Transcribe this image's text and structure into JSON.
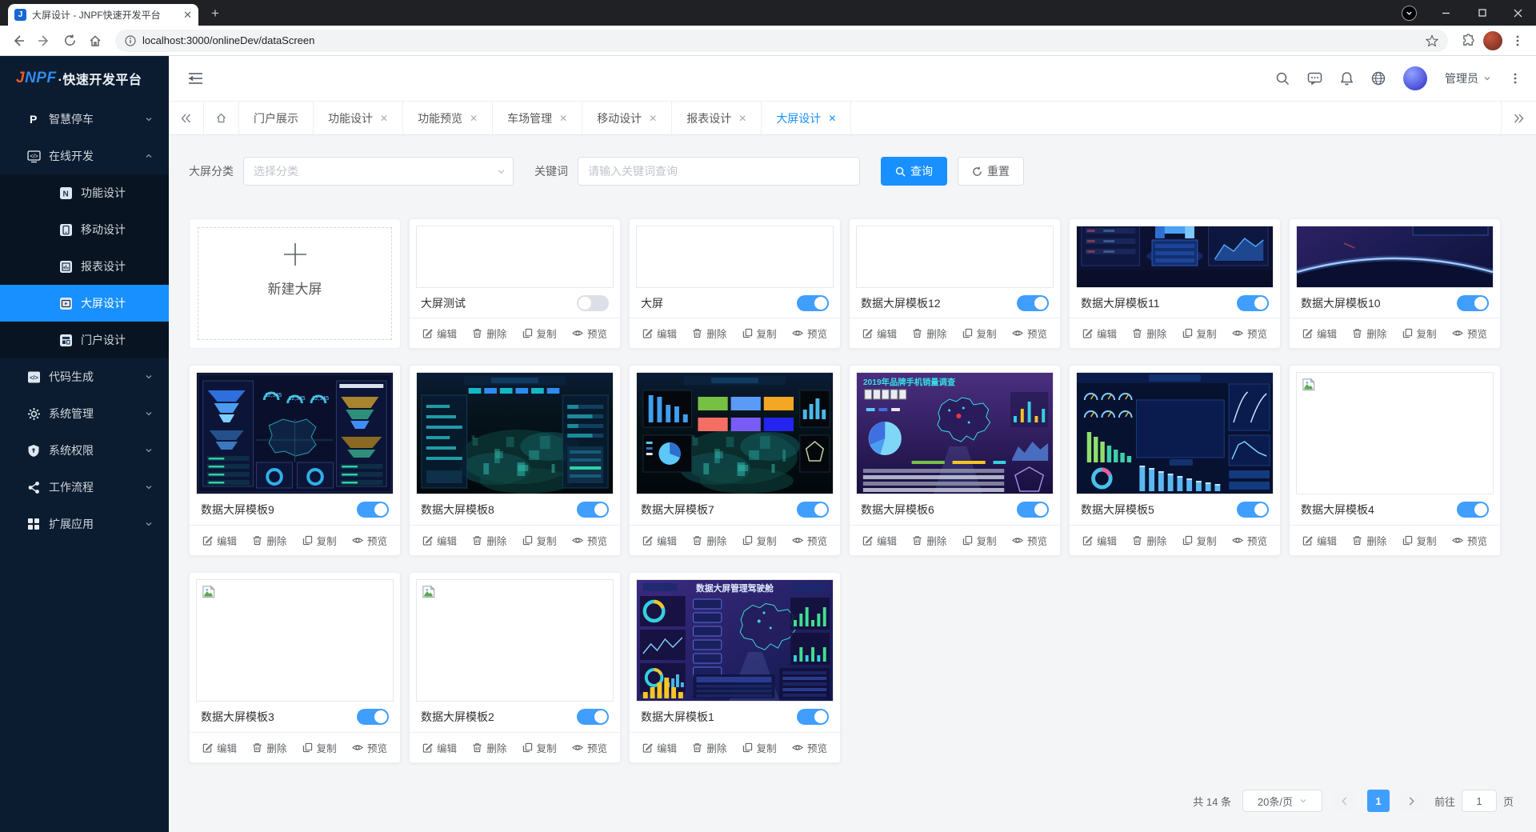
{
  "browser": {
    "tab_title": "大屏设计 - JNPF快速开发平台",
    "url": "localhost:3000/onlineDev/dataScreen"
  },
  "logo": {
    "j": "J",
    "npf": "NPF",
    "rest": "·快速开发平台"
  },
  "sidebar": {
    "items": [
      {
        "label": "智慧停车",
        "icon": "parking-p",
        "level": 1,
        "chevron": "down"
      },
      {
        "label": "在线开发",
        "icon": "online-dev",
        "level": 1,
        "chevron": "up"
      },
      {
        "label": "功能设计",
        "icon": "func-design",
        "level": 2
      },
      {
        "label": "移动设计",
        "icon": "mobile-design",
        "level": 2
      },
      {
        "label": "报表设计",
        "icon": "report-design",
        "level": 2
      },
      {
        "label": "大屏设计",
        "icon": "screen-design",
        "level": 2,
        "active": true
      },
      {
        "label": "门户设计",
        "icon": "portal-design",
        "level": 2
      },
      {
        "label": "代码生成",
        "icon": "code-gen",
        "level": 1,
        "chevron": "down"
      },
      {
        "label": "系统管理",
        "icon": "gear",
        "level": 1,
        "chevron": "down"
      },
      {
        "label": "系统权限",
        "icon": "shield",
        "level": 1,
        "chevron": "down"
      },
      {
        "label": "工作流程",
        "icon": "flow",
        "level": 1,
        "chevron": "down"
      },
      {
        "label": "扩展应用",
        "icon": "apps",
        "level": 1,
        "chevron": "down"
      }
    ]
  },
  "header": {
    "user": "管理员"
  },
  "page_tabs": [
    {
      "label": "门户展示",
      "closable": false,
      "active": false
    },
    {
      "label": "功能设计",
      "closable": true,
      "active": false
    },
    {
      "label": "功能预览",
      "closable": true,
      "active": false
    },
    {
      "label": "车场管理",
      "closable": true,
      "active": false
    },
    {
      "label": "移动设计",
      "closable": true,
      "active": false
    },
    {
      "label": "报表设计",
      "closable": true,
      "active": false
    },
    {
      "label": "大屏设计",
      "closable": true,
      "active": true
    }
  ],
  "filter": {
    "category_label": "大屏分类",
    "category_placeholder": "选择分类",
    "keyword_label": "关键词",
    "keyword_placeholder": "请输入关键词查询",
    "search_button": "查询",
    "reset_button": "重置"
  },
  "new_card": {
    "label": "新建大屏"
  },
  "card_actions": [
    "编辑",
    "删除",
    "复制",
    "预览"
  ],
  "cards": [
    {
      "title": "大屏测试",
      "enabled": false,
      "thumb": "blank",
      "row": 1
    },
    {
      "title": "大屏",
      "enabled": true,
      "thumb": "blank",
      "row": 1
    },
    {
      "title": "数据大屏模板12",
      "enabled": true,
      "thumb": "blank",
      "row": 1
    },
    {
      "title": "数据大屏模板11",
      "enabled": true,
      "thumb": "building",
      "row": 1
    },
    {
      "title": "数据大屏模板10",
      "enabled": true,
      "thumb": "space",
      "row": 1
    },
    {
      "title": "数据大屏模板9",
      "enabled": true,
      "thumb": "funnel",
      "row": 2
    },
    {
      "title": "数据大屏模板8",
      "enabled": true,
      "thumb": "city",
      "row": 2
    },
    {
      "title": "数据大屏模板7",
      "enabled": true,
      "thumb": "citytiles",
      "row": 2
    },
    {
      "title": "数据大屏模板6",
      "enabled": true,
      "thumb": "mapPurple",
      "row": 2,
      "thumb_title": "2019年品牌手机销量调查"
    },
    {
      "title": "数据大屏模板5",
      "enabled": true,
      "thumb": "bars",
      "row": 2
    },
    {
      "title": "数据大屏模板4",
      "enabled": true,
      "thumb": "broken",
      "row": 2
    },
    {
      "title": "数据大屏模板3",
      "enabled": true,
      "thumb": "broken",
      "row": 3
    },
    {
      "title": "数据大屏模板2",
      "enabled": true,
      "thumb": "broken",
      "row": 3
    },
    {
      "title": "数据大屏模板1",
      "enabled": true,
      "thumb": "mapViolet",
      "row": 3,
      "thumb_title": "数据大屏管理驾驶舱"
    }
  ],
  "pagination": {
    "total": "共 14 条",
    "page_size": "20条/页",
    "current": "1",
    "goto_label": "前往",
    "goto_value": "1",
    "page_suffix": "页"
  },
  "colors": {
    "primary": "#1890ff",
    "switch_on": "#409eff",
    "sidebar_bg": "#0c1c30",
    "submenu_bg": "#081421",
    "content_bg": "#f4f5f7"
  }
}
